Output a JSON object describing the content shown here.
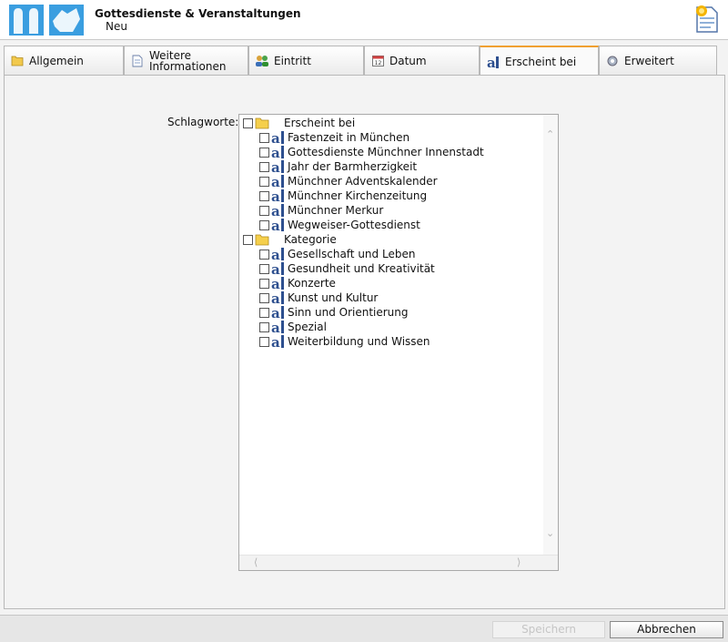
{
  "header": {
    "title": "Gottesdienste & Veranstaltungen",
    "subtitle": "Neu"
  },
  "tabs": [
    {
      "label": "Allgemein",
      "icon": "folder-icon",
      "active": false
    },
    {
      "label": "Weitere Informationen",
      "icon": "document-icon",
      "active": false
    },
    {
      "label": "Eintritt",
      "icon": "people-icon",
      "active": false
    },
    {
      "label": "Datum",
      "icon": "calendar-icon",
      "active": false
    },
    {
      "label": "Erscheint bei",
      "icon": "tag-a-icon",
      "active": true
    },
    {
      "label": "Erweitert",
      "icon": "gear-icon",
      "active": false
    }
  ],
  "form": {
    "keywords_label": "Schlagworte:"
  },
  "tree": {
    "groups": [
      {
        "label": "Erscheint bei",
        "items": [
          "Fastenzeit in München",
          "Gottesdienste Münchner Innenstadt",
          "Jahr der Barmherzigkeit",
          "Münchner Adventskalender",
          "Münchner Kirchenzeitung",
          "Münchner Merkur",
          "Wegweiser-Gottesdienst"
        ]
      },
      {
        "label": "Kategorie",
        "items": [
          "Gesellschaft und Leben",
          "Gesundheit und Kreativität",
          "Konzerte",
          "Kunst und Kultur",
          "Sinn und Orientierung",
          "Spezial",
          "Weiterbildung und Wissen"
        ]
      }
    ]
  },
  "buttons": {
    "save": "Speichern",
    "cancel": "Abbrechen"
  },
  "colors": {
    "active_tab_accent": "#f0a030",
    "logo_blue": "#3a9ee0"
  }
}
